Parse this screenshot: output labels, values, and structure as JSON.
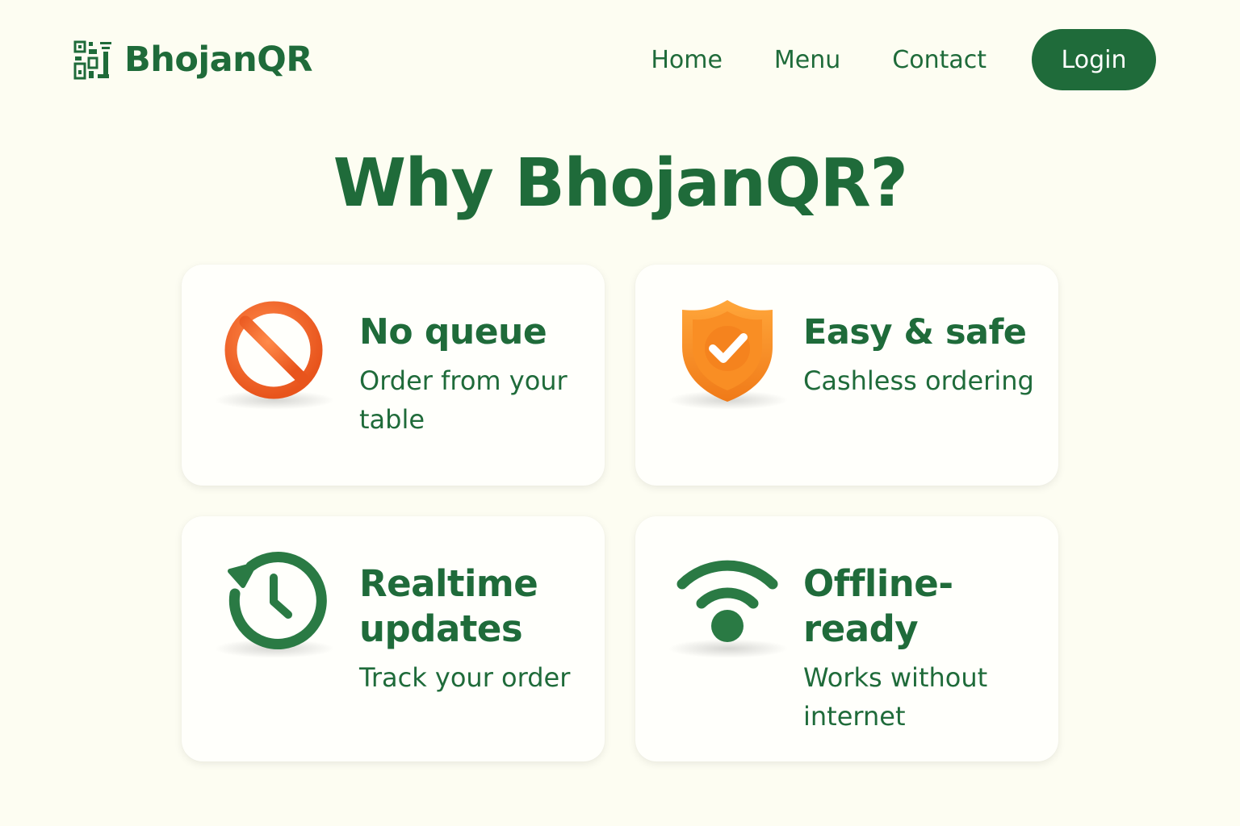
{
  "brand": {
    "name": "BhojanQR",
    "primary_color": "#1f6b3a",
    "background_color": "#fdfdf2"
  },
  "nav": {
    "items": [
      {
        "label": "Home"
      },
      {
        "label": "Menu"
      },
      {
        "label": "Contact"
      }
    ],
    "login_label": "Login"
  },
  "section": {
    "title": "Why BhojanQR?"
  },
  "features": [
    {
      "icon": "no-entry-icon",
      "title": "No queue",
      "description": "Order from your table",
      "icon_color": "#f06a2a"
    },
    {
      "icon": "shield-check-icon",
      "title": "Easy & safe",
      "description": "Cashless ordering",
      "icon_color": "#f78a22"
    },
    {
      "icon": "clock-refresh-icon",
      "title": "Realtime updates",
      "description": "Track your order",
      "icon_color": "#2a7a44"
    },
    {
      "icon": "wifi-icon",
      "title": "Offline-ready",
      "description": "Works without internet",
      "icon_color": "#2a7a44"
    }
  ]
}
